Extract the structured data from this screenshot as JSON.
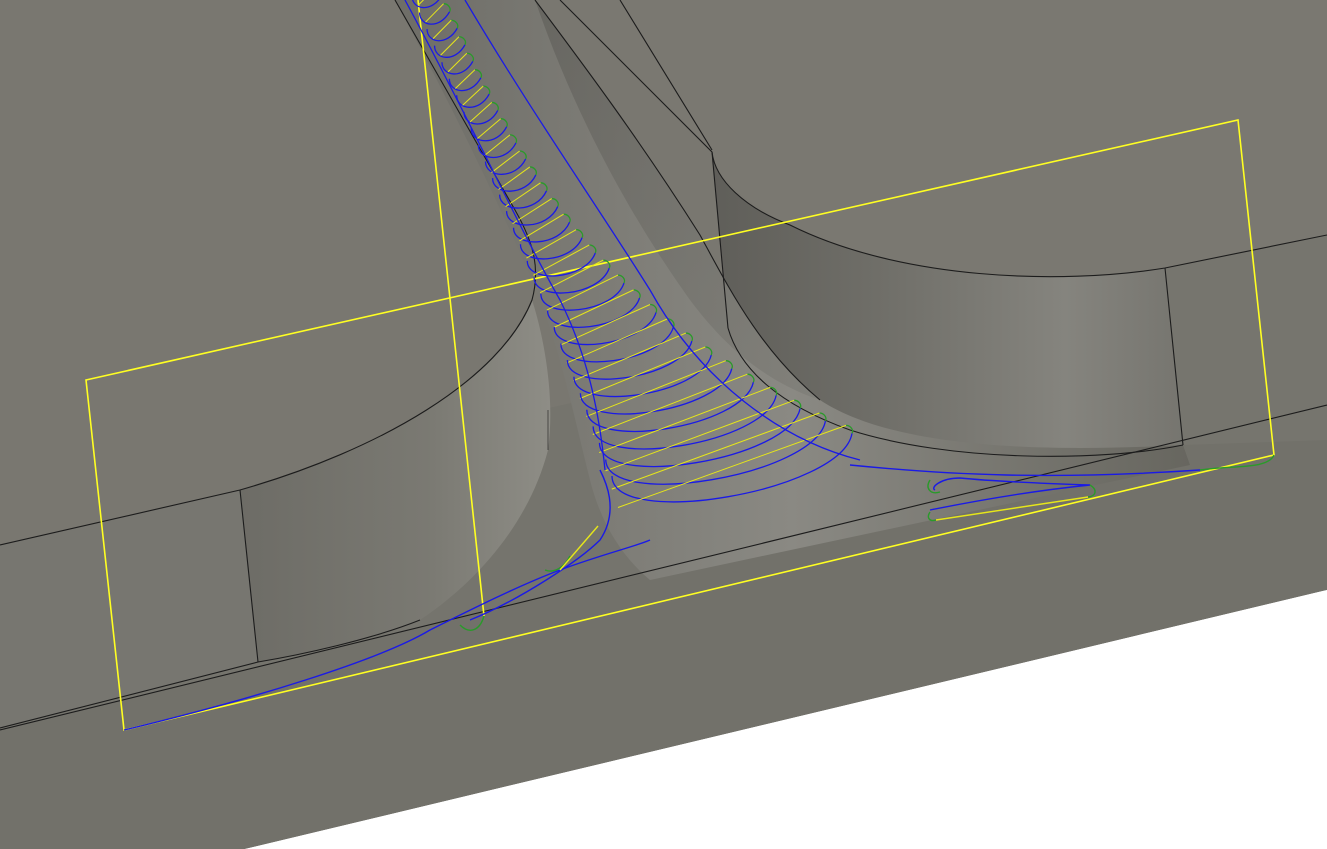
{
  "viewport": {
    "background": "#ffffff",
    "model_colors": {
      "top_face": "#797770",
      "lower_face": "#74736c",
      "front_face": "#76756e",
      "wall_dark": "#6a6963",
      "wall_light": "#8b8a83",
      "edge": "#1c1c1c"
    },
    "toolpath_colors": {
      "cutting": "#1a1ae6",
      "lead_link": "#2a9a2a",
      "rapid": "#e6e61a",
      "boundary": "#ffff22"
    },
    "toolpath_passes": 30
  }
}
